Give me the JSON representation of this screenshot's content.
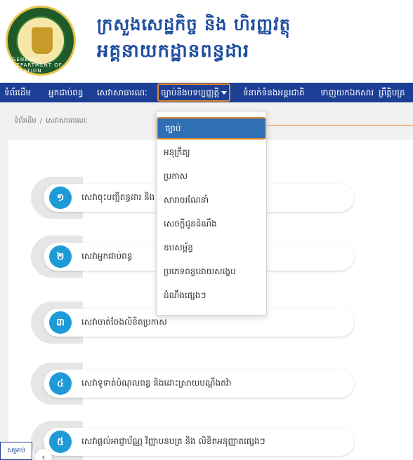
{
  "header": {
    "ministry_name": "ក្រសួងសេដ្ឋកិច្ច និង ហិរញ្ញវត្ថុ",
    "department_name": "អគ្គនាយកដ្ឋានពន្ធដារ",
    "seal_text": "GENERAL DEPARTMENT OF TAXATION"
  },
  "nav": {
    "items": [
      {
        "label": "ទំព័រដើម"
      },
      {
        "label": "អ្នកជាប់ពន្ធ"
      },
      {
        "label": "សេវាសាធារណៈ"
      },
      {
        "label": "ច្បាប់និងបទប្បញ្ញត្តិ"
      },
      {
        "label": "ទំនាក់ទំនងអន្តរជាតិ"
      },
      {
        "label": "ទាញយកឯកសារ"
      },
      {
        "label": "ព្រឹត្តិបត្រ"
      }
    ]
  },
  "breadcrumb": {
    "home": "ទំព័រដើម",
    "separator": "/",
    "current": "សេវាសាធារណៈ"
  },
  "services": [
    {
      "number": "១",
      "label": "សេវាចុះបញ្ជីពន្ធដារ និង"
    },
    {
      "number": "២",
      "label": "សេវាអ្នកជាប់ពន្ធ"
    },
    {
      "number": "៣",
      "label": "សេវាចាត់ចែងលិខិតប្រកាស"
    },
    {
      "number": "៤",
      "label": "សេវាទូទាត់បំណុលពន្ធ និងដោះស្រាយបណ្តឹងតវ៉ា"
    },
    {
      "number": "៥",
      "label": "សេវាផ្តល់អាជ្ញាប័ណ្ណ វិញ្ញាបនបត្រ និង លិខិតអនុញ្ញាតផ្សេងៗ"
    }
  ],
  "dropdown": {
    "items": [
      {
        "label": "ច្បាប់"
      },
      {
        "label": "អនុក្រឹត្យ"
      },
      {
        "label": "ប្រកាស"
      },
      {
        "label": "សារាចរណែនាំ"
      },
      {
        "label": "សេចក្តីជូនដំណឹង"
      },
      {
        "label": "ឧបសម្ព័ន្ធ"
      },
      {
        "label": "ប្រភេទពន្ធដោយសង្ខេប"
      },
      {
        "label": "ដំណឹងផ្សេងៗ"
      }
    ]
  },
  "side_tab": {
    "label": "សម្រាប់"
  },
  "collapse": {
    "label": "‹"
  },
  "colors": {
    "nav_bg": "#1c3f95",
    "accent_blue": "#1e9bd7",
    "highlight_orange": "#e08a2b",
    "title_blue": "#1f4ea0"
  }
}
